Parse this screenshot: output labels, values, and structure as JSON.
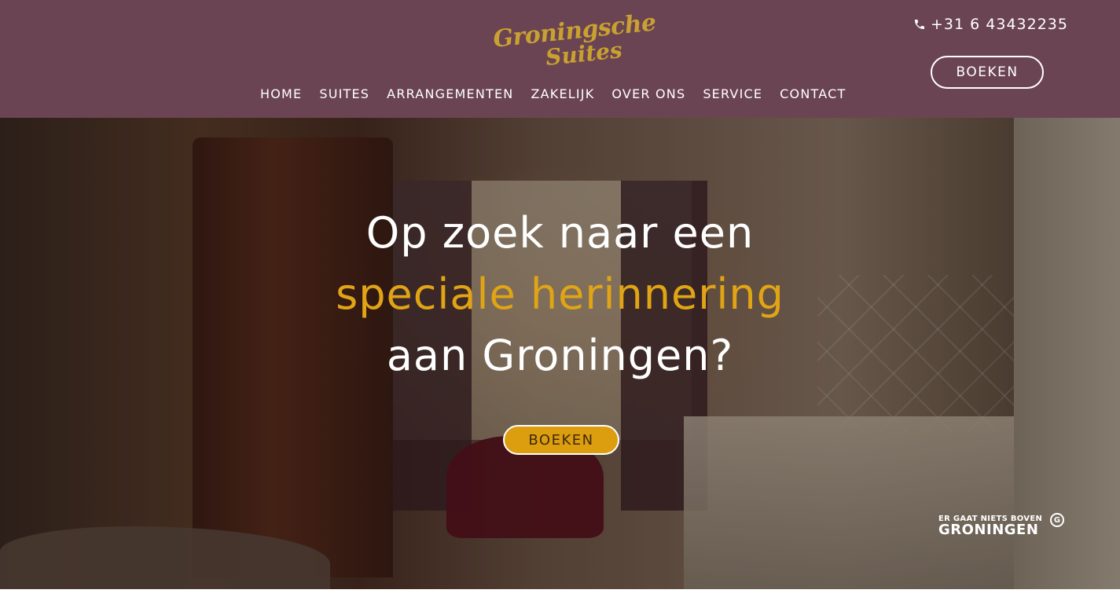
{
  "header": {
    "logo_line1": "Groningsche",
    "logo_line2": "Suites",
    "phone": "+31 6 43432235",
    "book_label": "BOEKEN",
    "nav": [
      {
        "label": "HOME"
      },
      {
        "label": "SUITES"
      },
      {
        "label": "ARRANGEMENTEN"
      },
      {
        "label": "ZAKELIJK"
      },
      {
        "label": "OVER ONS"
      },
      {
        "label": "SERVICE"
      },
      {
        "label": "CONTACT"
      }
    ]
  },
  "hero": {
    "line1": "Op zoek naar een",
    "line2": "speciale herinnering",
    "line3": "aan Groningen?",
    "book_label": "BOEKEN",
    "badge_small": "ER GAAT NIETS BOVEN",
    "badge_big": "GRONINGEN",
    "badge_mark": "G"
  },
  "colors": {
    "header_bg": "#6b4453",
    "gold": "#e0a415",
    "logo": "#c9a131"
  },
  "icons": {
    "phone": "phone-icon"
  }
}
